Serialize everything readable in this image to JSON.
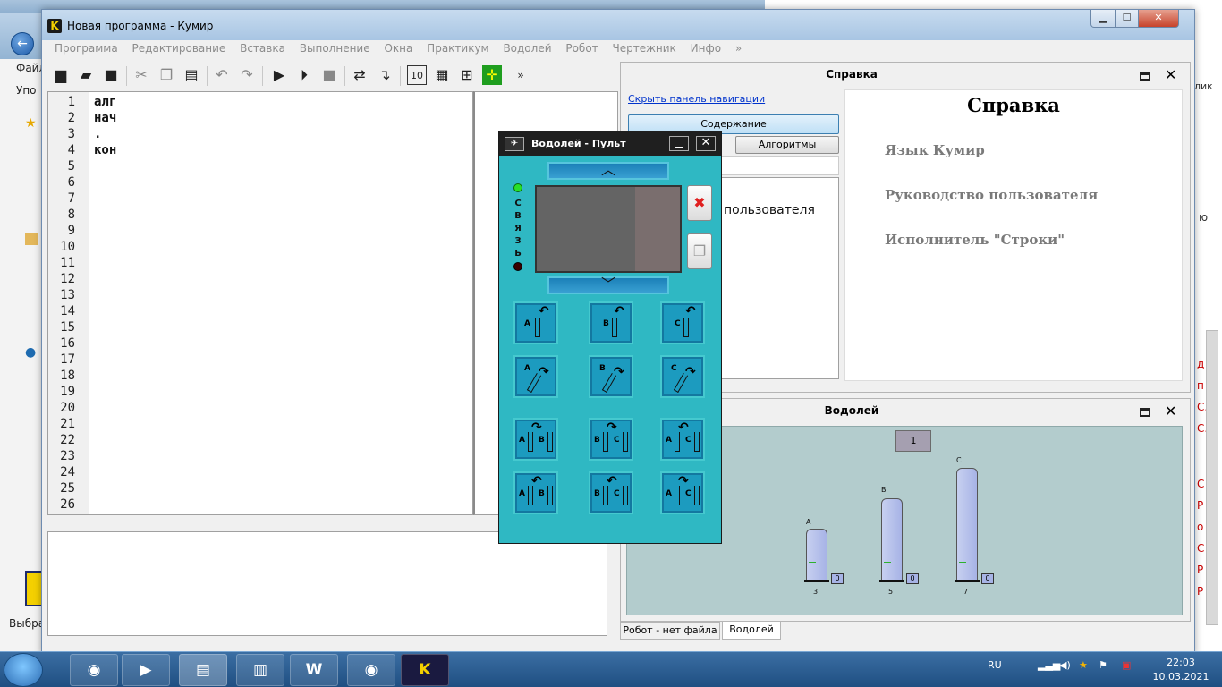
{
  "background": {
    "left_menu": [
      "Файл",
      "Упо"
    ],
    "left_bottom": "Выбра",
    "right_marks": [
      "д",
      "п",
      "C.",
      "C.",
      "С",
      "Р",
      "о",
      "С",
      "Р",
      "Р"
    ],
    "right_top_text": "лик",
    "right_mid_text": "ю"
  },
  "window": {
    "title": "Новая программа - Кумир",
    "icon_letter": "K",
    "minimize": "▁",
    "maximize": "☐",
    "close": "✕"
  },
  "menu": [
    "Программа",
    "Редактирование",
    "Вставка",
    "Выполнение",
    "Окна",
    "Практикум",
    "Водолей",
    "Робот",
    "Чертежник",
    "Инфо",
    "»"
  ],
  "toolbar": {
    "more": "»"
  },
  "editor": {
    "line_numbers": [
      "1",
      "2",
      "3",
      "4",
      "5",
      "6",
      "7",
      "8",
      "9",
      "10",
      "11",
      "12",
      "13",
      "14",
      "15",
      "16",
      "17",
      "18",
      "19",
      "20",
      "21",
      "22",
      "23",
      "24",
      "25",
      "26"
    ],
    "code_lines": [
      "алг",
      "нач",
      ".",
      "кон"
    ]
  },
  "help_dock": {
    "title": "Справка",
    "hide_nav": "Скрыть панель навигации",
    "contents_button": "Содержание",
    "algorithms_button": "Алгоритмы",
    "nav_visible_text": "пользователя",
    "help_heading": "Справка",
    "help_links": [
      "Язык Кумир",
      "Руководство пользователя",
      "Исполнитель \"Строки\""
    ]
  },
  "vodoley_dock": {
    "title": "Водолей",
    "task_value": "1",
    "vessels": [
      {
        "label": "A",
        "capacity": "3",
        "count": "0"
      },
      {
        "label": "B",
        "capacity": "5",
        "count": "0"
      },
      {
        "label": "C",
        "capacity": "7",
        "count": "0"
      }
    ]
  },
  "tabs": [
    "Робот - нет файла",
    "Водолей"
  ],
  "pult": {
    "title": "Водолей - Пульт",
    "pin": "✈",
    "min": "▁",
    "close": "✕",
    "up_arrow": "︿",
    "down_arrow": "﹀",
    "link_letters": [
      "С",
      "В",
      "Я",
      "З",
      "Ь"
    ],
    "clear_icon": "✖",
    "copy_icon": "❐",
    "row1": [
      "A",
      "B",
      "C"
    ],
    "row2": [
      "A",
      "B",
      "C"
    ],
    "row3": [
      [
        "A",
        "B"
      ],
      [
        "B",
        "C"
      ],
      [
        "A",
        "C"
      ]
    ],
    "row4": [
      [
        "A",
        "B"
      ],
      [
        "B",
        "C"
      ],
      [
        "A",
        "C"
      ]
    ]
  },
  "taskbar": {
    "lang": "RU",
    "time": "22:03",
    "date": "10.03.2021",
    "apps": [
      "chrome",
      "player",
      "explorer",
      "winrar",
      "word",
      "chrome-user",
      "kumir"
    ],
    "word_letter": "W",
    "kumir_letter": "K"
  }
}
